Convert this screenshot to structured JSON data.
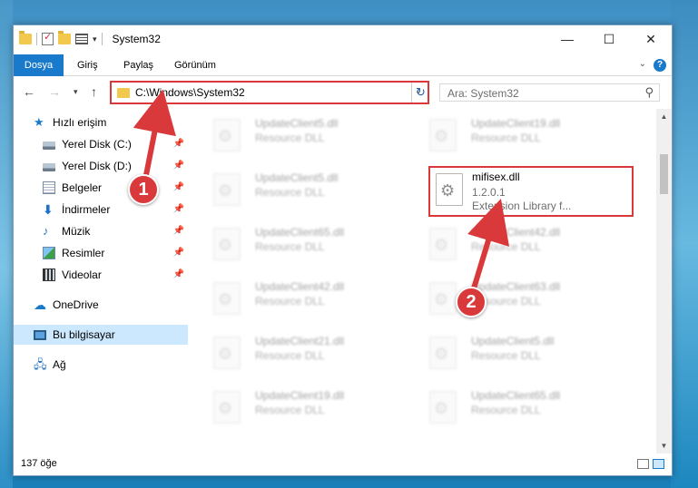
{
  "window": {
    "title": "System32",
    "minimize_glyph": "—",
    "maximize_glyph": "☐",
    "close_glyph": "✕"
  },
  "ribbon": {
    "tabs": [
      "Dosya",
      "Giriş",
      "Paylaş",
      "Görünüm"
    ],
    "accent": "#1979ca",
    "help_glyph": "?"
  },
  "address": {
    "path": "C:\\Windows\\System32",
    "search_placeholder": "Ara: System32"
  },
  "sidebar": {
    "items": [
      {
        "label": "Hızlı erişim",
        "icon": "star-icon"
      },
      {
        "label": "Yerel Disk (C:)",
        "icon": "drive-icon"
      },
      {
        "label": "Yerel Disk (D:)",
        "icon": "drive-icon"
      },
      {
        "label": "Belgeler",
        "icon": "documents-icon"
      },
      {
        "label": "İndirmeler",
        "icon": "download-icon"
      },
      {
        "label": "Müzik",
        "icon": "music-icon"
      },
      {
        "label": "Resimler",
        "icon": "pictures-icon"
      },
      {
        "label": "Videolar",
        "icon": "video-icon"
      },
      {
        "label": "OneDrive",
        "icon": "cloud-icon"
      },
      {
        "label": "Bu bilgisayar",
        "icon": "computer-icon"
      },
      {
        "label": "Ağ",
        "icon": "network-icon"
      }
    ]
  },
  "files": {
    "left": [
      {
        "name": "UpdateClient5.dll",
        "type": "Resource DLL"
      },
      {
        "name": "UpdateClient5.dll",
        "type": "Resource DLL"
      },
      {
        "name": "UpdateClient65.dll",
        "type": "Resource DLL"
      },
      {
        "name": "UpdateClient42.dll",
        "type": "Resource DLL"
      },
      {
        "name": "UpdateClient21.dll",
        "type": "Resource DLL"
      },
      {
        "name": "UpdateClient19.dll",
        "type": "Resource DLL"
      }
    ],
    "right": [
      {
        "name": "UpdateClient19.dll",
        "type": "Resource DLL"
      },
      {
        "name": "UpdateClient42.dll",
        "type": "Resource DLL"
      },
      {
        "name": "UpdateClient63.dll",
        "type": "Resource DLL"
      },
      {
        "name": "UpdateClient5.dll",
        "type": "Resource DLL"
      },
      {
        "name": "UpdateClient65.dll",
        "type": "Resource DLL"
      }
    ],
    "highlighted": {
      "name": "mifisex.dll",
      "version": "1.2.0.1",
      "description": "Extension Library f..."
    }
  },
  "status": {
    "count": "137 öğe"
  },
  "annotations": {
    "callout_1": "1",
    "callout_2": "2",
    "highlight_color": "#d9393b"
  }
}
